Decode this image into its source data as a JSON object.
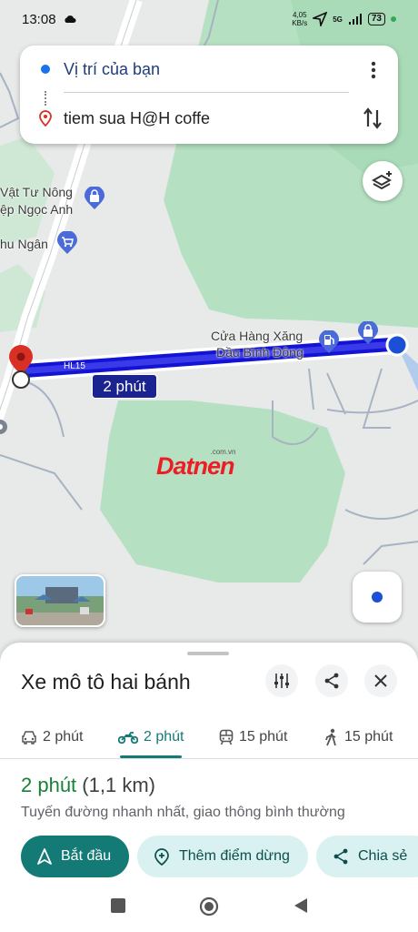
{
  "status_bar": {
    "time": "13:08",
    "net_speed_value": "4,05",
    "net_speed_unit": "KB/s",
    "network": "5G",
    "battery": "73"
  },
  "directions": {
    "origin": "Vị trí của bạn",
    "destination": "tiem sua H@H coffe"
  },
  "map": {
    "labels": {
      "store1_line1": "Vật Tư Nông",
      "store1_line2": "ệp Ngọc Anh",
      "store2": "hu Ngân",
      "gas_line1": "Cửa Hàng Xăng",
      "gas_line2": "Dầu Bình Đông",
      "road": "HL15"
    },
    "route_time_badge": "2 phút",
    "watermark_small": ".com.vn",
    "watermark_main": "Datnen"
  },
  "sheet": {
    "title": "Xe mô tô hai bánh",
    "modes": [
      {
        "icon": "car-icon",
        "label": "2 phút"
      },
      {
        "icon": "motorcycle-icon",
        "label": "2 phút"
      },
      {
        "icon": "transit-icon",
        "label": "15 phút"
      },
      {
        "icon": "walk-icon",
        "label": "15 phút"
      }
    ],
    "active_mode": 1,
    "route_time": "2 phút",
    "route_distance": "(1,1 km)",
    "route_description": "Tuyến đường nhanh nhất, giao thông bình thường",
    "buttons": {
      "start": "Bắt đầu",
      "add_stop": "Thêm điểm dừng",
      "share": "Chia sẻ"
    }
  },
  "colors": {
    "route": "#1a1ae0",
    "accent": "#137a76",
    "origin_blue": "#1a73e8",
    "destination_red": "#d93025"
  }
}
